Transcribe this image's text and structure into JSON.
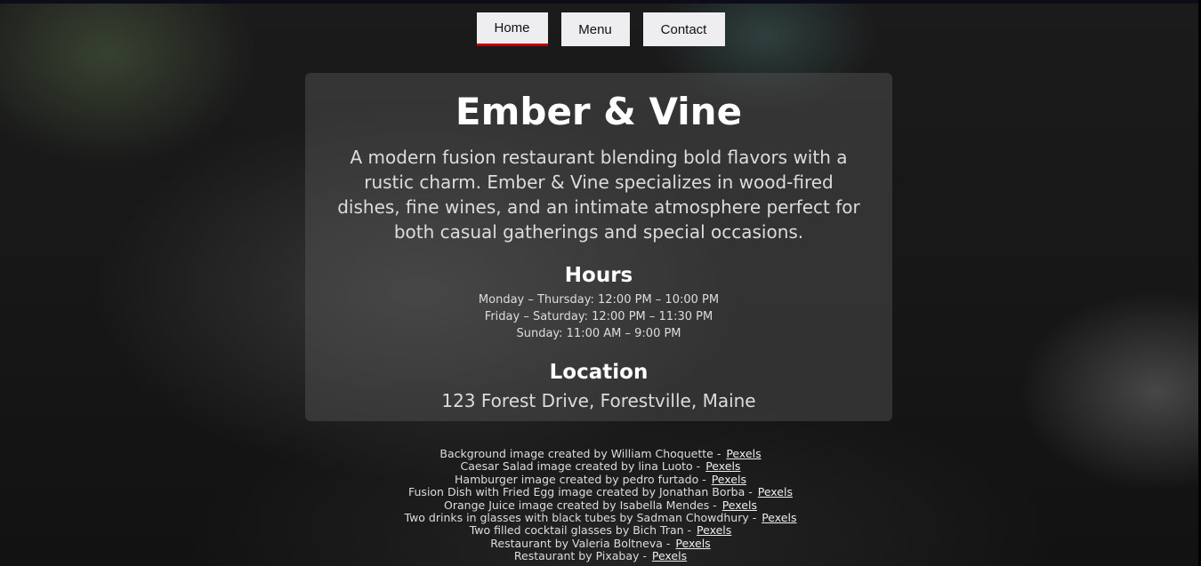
{
  "nav": {
    "items": [
      {
        "label": "Home",
        "active": true
      },
      {
        "label": "Menu",
        "active": false
      },
      {
        "label": "Contact",
        "active": false
      }
    ]
  },
  "colors": {
    "accent": "#bb0000",
    "nav_bg": "#eeeef0"
  },
  "restaurant": {
    "name": "Ember & Vine",
    "description": "A modern fusion restaurant blending bold flavors with a rustic charm. Ember & Vine specializes in wood-fired dishes, fine wines, and an intimate atmosphere perfect for both casual gatherings and special occasions."
  },
  "hours": {
    "title": "Hours",
    "lines": [
      "Monday – Thursday: 12:00 PM – 10:00 PM",
      "Friday – Saturday: 12:00 PM – 11:30 PM",
      "Sunday: 11:00 AM – 9:00 PM"
    ]
  },
  "location": {
    "title": "Location",
    "address": "123 Forest Drive, Forestville, Maine"
  },
  "credits": [
    {
      "text": "Background image created by William Choquette -",
      "link": "Pexels"
    },
    {
      "text": "Caesar Salad image created by lina Luoto -",
      "link": "Pexels"
    },
    {
      "text": "Hamburger image created by pedro furtado -",
      "link": "Pexels"
    },
    {
      "text": "Fusion Dish with Fried Egg image created by Jonathan Borba -",
      "link": "Pexels"
    },
    {
      "text": "Orange Juice image created by Isabella Mendes -",
      "link": "Pexels"
    },
    {
      "text": "Two drinks in glasses with black tubes by Sadman Chowdhury -",
      "link": "Pexels"
    },
    {
      "text": "Two filled cocktail glasses by Bich Tran -",
      "link": "Pexels"
    },
    {
      "text": "Restaurant by Valeria Boltneva -",
      "link": "Pexels"
    },
    {
      "text": "Restaurant by Pixabay -",
      "link": "Pexels"
    }
  ]
}
